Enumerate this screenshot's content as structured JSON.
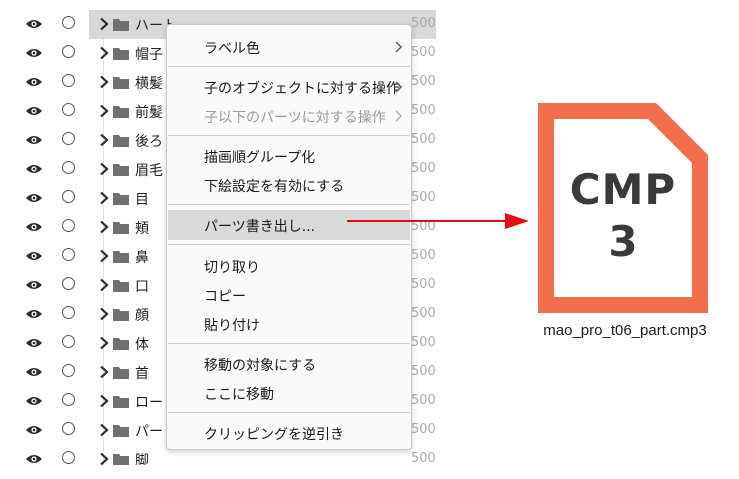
{
  "layers": [
    {
      "name": "ハート",
      "opacity": "500",
      "selected": true
    },
    {
      "name": "帽子",
      "opacity": "500"
    },
    {
      "name": "横髪",
      "opacity": "500"
    },
    {
      "name": "前髪",
      "opacity": "500"
    },
    {
      "name": "後ろ",
      "opacity": "500"
    },
    {
      "name": "眉毛",
      "opacity": "500"
    },
    {
      "name": "目",
      "opacity": "500"
    },
    {
      "name": "頬",
      "opacity": "500"
    },
    {
      "name": "鼻",
      "opacity": "500"
    },
    {
      "name": "口",
      "opacity": "500"
    },
    {
      "name": "顔",
      "opacity": "500"
    },
    {
      "name": "体",
      "opacity": "500"
    },
    {
      "name": "首",
      "opacity": "500"
    },
    {
      "name": "ロー",
      "opacity": "500"
    },
    {
      "name": "パー",
      "opacity": "500"
    },
    {
      "name": "脚",
      "opacity": "500"
    }
  ],
  "context_menu": {
    "items": [
      {
        "label": "ラベル色",
        "submenu": true
      },
      {
        "label": "子のオブジェクトに対する操作",
        "submenu": true
      },
      {
        "label": "子以下のパーツに対する操作",
        "submenu": true,
        "disabled": true
      },
      {
        "label": "描画順グループ化"
      },
      {
        "label": "下絵設定を有効にする"
      },
      {
        "label": "パーツ書き出し...",
        "hover": true
      },
      {
        "label": "切り取り"
      },
      {
        "label": "コピー"
      },
      {
        "label": "貼り付け"
      },
      {
        "label": "移動の対象にする"
      },
      {
        "label": "ここに移動"
      },
      {
        "label": "クリッピングを逆引き"
      }
    ]
  },
  "file": {
    "icon_line1": "CMP",
    "icon_line2": "3",
    "name": "mao_pro_t06_part.cmp3",
    "icon_color": "#F36E4C"
  },
  "colors": {
    "arrow": "#E01010",
    "selection": "#D8D8D8",
    "menu_hover": "#D9D9D9"
  }
}
